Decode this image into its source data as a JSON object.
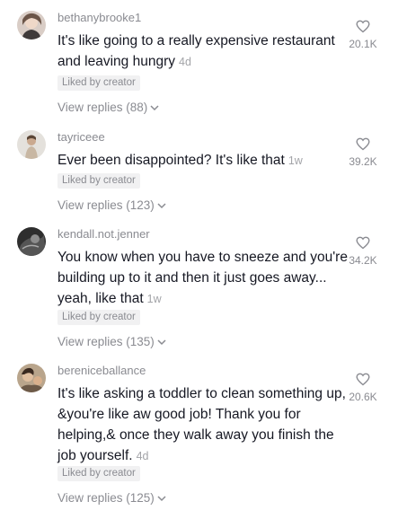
{
  "comments": [
    {
      "username": "bethanybrooke1",
      "text": "It's like going to a really expensive restaurant and leaving hungry",
      "time": "4d",
      "liked_badge": "Liked by creator",
      "replies": "View replies (88)",
      "likes": "20.1K"
    },
    {
      "username": "tayriceee",
      "text": "Ever been disappointed? It's like that",
      "time": "1w",
      "liked_badge": "Liked by creator",
      "replies": "View replies (123)",
      "likes": "39.2K"
    },
    {
      "username": "kendall.not.jenner",
      "text": "You know when you have to sneeze and you're building up to it and then it just goes away... yeah, like that",
      "time": "1w",
      "liked_badge": "Liked by creator",
      "replies": "View replies (135)",
      "likes": "34.2K"
    },
    {
      "username": "berenice​ballance",
      "text": "It's like asking a toddler to clean something up, &you're like aw good job! Thank you for helping,& once they walk away you finish the job yourself.",
      "time": "4d",
      "liked_badge": "Liked by creator",
      "replies": "View replies (125)",
      "likes": "20.6K"
    }
  ],
  "icons": {
    "like": "heart-outline-icon",
    "expand": "chevron-down-icon"
  },
  "colors": {
    "text": "#161823",
    "secondary": "#8a8b91",
    "badge_bg": "#f1f1f2"
  }
}
